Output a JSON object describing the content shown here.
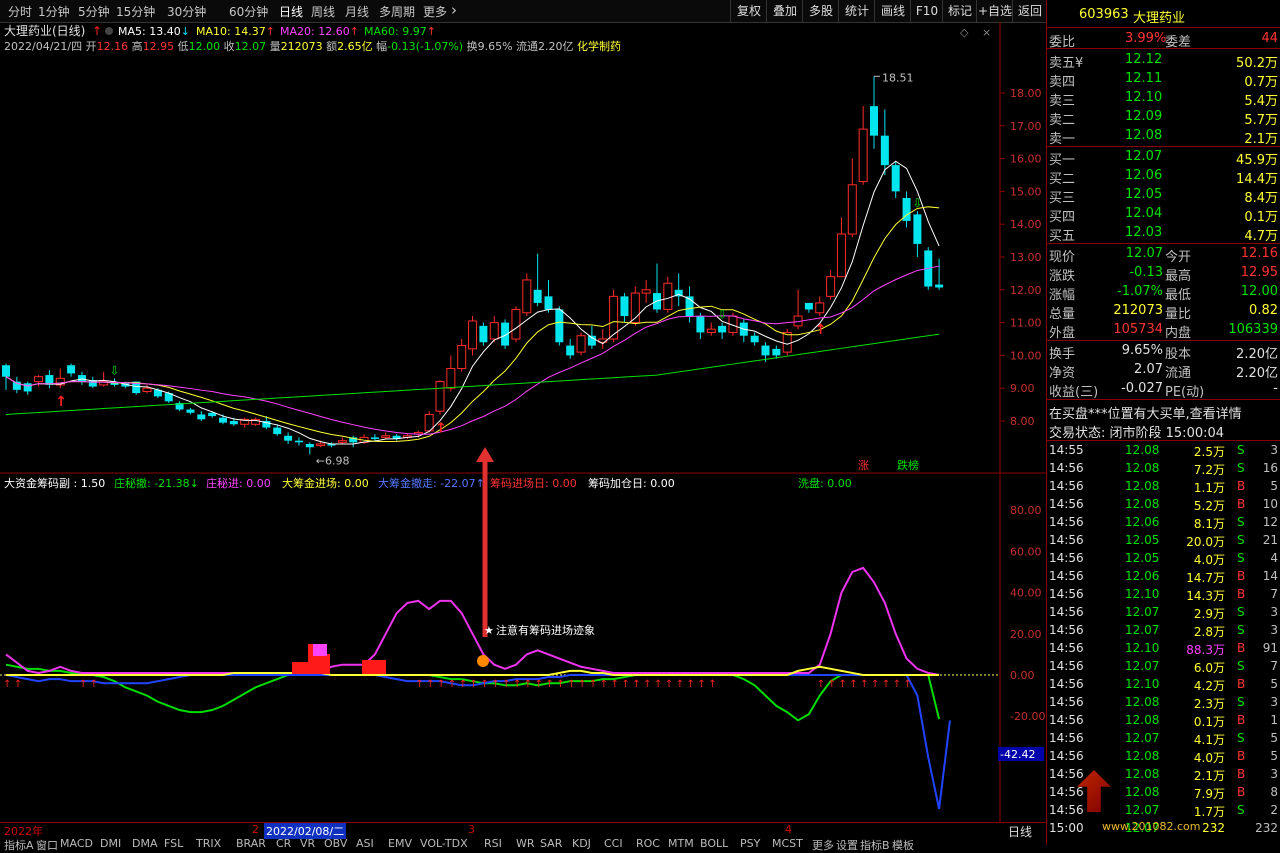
{
  "toolbar": {
    "periods": [
      "分时",
      "1分钟",
      "5分钟",
      "15分钟",
      "30分钟",
      "60分钟",
      "日线",
      "周线",
      "月线",
      "多周期",
      "更多"
    ],
    "active_period": "日线",
    "more_icon": "chevron-right-icon",
    "right_buttons": [
      "复权",
      "叠加",
      "多股",
      "统计",
      "画线",
      "F10",
      "标记",
      "+自选",
      "返回"
    ]
  },
  "main_info": {
    "title": "大理药业(日线)",
    "ma": [
      {
        "label": "MA5: 13.40",
        "arrow": "↓",
        "color": "#ffffff"
      },
      {
        "label": "MA10: 14.37",
        "arrow": "↑",
        "color": "#ffff33"
      },
      {
        "label": "MA20: 12.60",
        "arrow": "↑",
        "color": "#ff44ff"
      },
      {
        "label": "MA60: 9.97",
        "arrow": "↑",
        "color": "#00e000"
      }
    ],
    "quote_date": "2022/04/21/四",
    "quote_items": [
      {
        "label": "开",
        "value": "12.16",
        "color": "#ff3333"
      },
      {
        "label": "高",
        "value": "12.95",
        "color": "#ff3333"
      },
      {
        "label": "低",
        "value": "12.00",
        "color": "#00e000"
      },
      {
        "label": "收",
        "value": "12.07",
        "color": "#00e000"
      },
      {
        "label": "量",
        "value": "212073",
        "color": "#ffff33"
      },
      {
        "label": "额",
        "value": "2.65亿",
        "color": "#ffff33"
      },
      {
        "label": "幅",
        "value": "-0.13(-1.07%)",
        "color": "#00e000"
      },
      {
        "label": "换",
        "value": "9.65%",
        "color": "#c0c0c0"
      },
      {
        "label": "流通",
        "value": "2.20亿",
        "color": "#c0c0c0"
      }
    ],
    "industry": "化学制药",
    "high_label": "18.51",
    "low_label": "6.98",
    "badges": [
      "涨",
      "跌榜"
    ]
  },
  "indicator": {
    "items": [
      {
        "text": "大资金筹码副 : 1.50",
        "color": "#ffffff"
      },
      {
        "text": "庄秘撤: -21.38↓",
        "color": "#00e000"
      },
      {
        "text": "庄秘进: 0.00",
        "color": "#ff44ff"
      },
      {
        "text": "大筹金进场: 0.00",
        "color": "#ffff33"
      },
      {
        "text": "大筹金撤走: -22.07↑",
        "color": "#5577ff"
      },
      {
        "text": "筹码进场日: 0.00",
        "color": "#ff3333"
      },
      {
        "text": "筹码加仓日: 0.00",
        "color": "#ffffff"
      },
      {
        "text": "洗盘: 0.00",
        "color": "#00e000"
      }
    ],
    "annotation": "注意有筹码进场迹象",
    "current_value": "-42.42"
  },
  "axis_main": [
    "18.00",
    "17.00",
    "16.00",
    "15.00",
    "14.00",
    "13.00",
    "12.00",
    "11.00",
    "10.00",
    "9.00",
    "8.00"
  ],
  "axis_ind": [
    "80.00",
    "60.00",
    "40.00",
    "20.00",
    "0.00",
    "-20.00"
  ],
  "timeline": {
    "labels": [
      "2022年",
      "2",
      "2022/02/08/二",
      "3",
      "4"
    ],
    "period": "日线"
  },
  "bottom_tabs": [
    "指标A",
    "窗口",
    "MACD",
    "DMI",
    "DMA",
    "FSL",
    "TRIX",
    "BRAR",
    "CR",
    "VR",
    "OBV",
    "ASI",
    "EMV",
    "VOL-TDX",
    "RSI",
    "WR",
    "SAR",
    "KDJ",
    "CCI",
    "ROC",
    "MTM",
    "BOLL",
    "PSY",
    "MCST",
    "更多",
    "设置",
    "指标B",
    "模板"
  ],
  "quote_panel": {
    "code": "603963",
    "name": "大理药业",
    "webi": {
      "label": "委比",
      "value": "3.99%",
      "label2": "委差",
      "value2": "44"
    },
    "sells": [
      {
        "label": "卖五",
        "price": "12.12",
        "vol": "50.2万"
      },
      {
        "label": "卖四",
        "price": "12.11",
        "vol": "0.7万"
      },
      {
        "label": "卖三",
        "price": "12.10",
        "vol": "5.4万"
      },
      {
        "label": "卖二",
        "price": "12.09",
        "vol": "5.7万"
      },
      {
        "label": "卖一",
        "price": "12.08",
        "vol": "2.1万"
      }
    ],
    "sell5_mark": "¥",
    "buys": [
      {
        "label": "买一",
        "price": "12.07",
        "vol": "45.9万"
      },
      {
        "label": "买二",
        "price": "12.06",
        "vol": "14.4万"
      },
      {
        "label": "买三",
        "price": "12.05",
        "vol": "8.4万"
      },
      {
        "label": "买四",
        "price": "12.04",
        "vol": "0.1万"
      },
      {
        "label": "买五",
        "price": "12.03",
        "vol": "4.7万"
      }
    ],
    "stats": [
      {
        "l1": "现价",
        "v1": "12.07",
        "c1": "#00e000",
        "l2": "今开",
        "v2": "12.16",
        "c2": "#ff3333"
      },
      {
        "l1": "涨跌",
        "v1": "-0.13",
        "c1": "#00e000",
        "l2": "最高",
        "v2": "12.95",
        "c2": "#ff3333"
      },
      {
        "l1": "涨幅",
        "v1": "-1.07%",
        "c1": "#00e000",
        "l2": "最低",
        "v2": "12.00",
        "c2": "#00e000"
      },
      {
        "l1": "总量",
        "v1": "212073",
        "c1": "#ffff33",
        "l2": "量比",
        "v2": "0.82",
        "c2": "#ffff33"
      },
      {
        "l1": "外盘",
        "v1": "105734",
        "c1": "#ff3333",
        "l2": "内盘",
        "v2": "106339",
        "c2": "#00e000"
      }
    ],
    "stats2": [
      {
        "l1": "换手",
        "v1": "9.65%",
        "l2": "股本",
        "v2": "2.20亿"
      },
      {
        "l1": "净资",
        "v1": "2.07",
        "l2": "流通",
        "v2": "2.20亿"
      },
      {
        "l1": "收益(三)",
        "v1": "-0.027",
        "l2": "PE(动)",
        "v2": "-"
      }
    ],
    "notice": "在买盘***位置有大买单,查看详情",
    "status": "交易状态: 闭市阶段 15:00:04",
    "ticks": [
      {
        "t": "14:55",
        "p": "12.08",
        "v": "2.5万",
        "s": "S",
        "n": "3",
        "pc": "#00e000",
        "vc": "#ffff33"
      },
      {
        "t": "14:56",
        "p": "12.08",
        "v": "7.2万",
        "s": "S",
        "n": "16",
        "pc": "#00e000",
        "vc": "#ffff33"
      },
      {
        "t": "14:56",
        "p": "12.08",
        "v": "1.1万",
        "s": "B",
        "n": "5",
        "pc": "#00e000",
        "vc": "#ffff33"
      },
      {
        "t": "14:56",
        "p": "12.08",
        "v": "5.2万",
        "s": "B",
        "n": "10",
        "pc": "#00e000",
        "vc": "#ffff33"
      },
      {
        "t": "14:56",
        "p": "12.06",
        "v": "8.1万",
        "s": "S",
        "n": "12",
        "pc": "#00e000",
        "vc": "#ffff33"
      },
      {
        "t": "14:56",
        "p": "12.05",
        "v": "20.0万",
        "s": "S",
        "n": "21",
        "pc": "#00e000",
        "vc": "#ffff33"
      },
      {
        "t": "14:56",
        "p": "12.05",
        "v": "4.0万",
        "s": "S",
        "n": "4",
        "pc": "#00e000",
        "vc": "#ffff33"
      },
      {
        "t": "14:56",
        "p": "12.06",
        "v": "14.7万",
        "s": "B",
        "n": "14",
        "pc": "#00e000",
        "vc": "#ffff33"
      },
      {
        "t": "14:56",
        "p": "12.10",
        "v": "14.3万",
        "s": "B",
        "n": "7",
        "pc": "#00e000",
        "vc": "#ffff33"
      },
      {
        "t": "14:56",
        "p": "12.07",
        "v": "2.9万",
        "s": "S",
        "n": "3",
        "pc": "#00e000",
        "vc": "#ffff33"
      },
      {
        "t": "14:56",
        "p": "12.07",
        "v": "2.8万",
        "s": "S",
        "n": "3",
        "pc": "#00e000",
        "vc": "#ffff33"
      },
      {
        "t": "14:56",
        "p": "12.10",
        "v": "88.3万",
        "s": "B",
        "n": "91",
        "pc": "#00e000",
        "vc": "#ff44ff"
      },
      {
        "t": "14:56",
        "p": "12.07",
        "v": "6.0万",
        "s": "S",
        "n": "7",
        "pc": "#00e000",
        "vc": "#ffff33"
      },
      {
        "t": "14:56",
        "p": "12.10",
        "v": "4.2万",
        "s": "B",
        "n": "5",
        "pc": "#00e000",
        "vc": "#ffff33"
      },
      {
        "t": "14:56",
        "p": "12.08",
        "v": "2.3万",
        "s": "S",
        "n": "3",
        "pc": "#00e000",
        "vc": "#ffff33"
      },
      {
        "t": "14:56",
        "p": "12.08",
        "v": "0.1万",
        "s": "B",
        "n": "1",
        "pc": "#00e000",
        "vc": "#ffff33"
      },
      {
        "t": "14:56",
        "p": "12.07",
        "v": "4.1万",
        "s": "S",
        "n": "5",
        "pc": "#00e000",
        "vc": "#ffff33"
      },
      {
        "t": "14:56",
        "p": "12.08",
        "v": "4.0万",
        "s": "B",
        "n": "5",
        "pc": "#00e000",
        "vc": "#ffff33"
      },
      {
        "t": "14:56",
        "p": "12.08",
        "v": "2.1万",
        "s": "B",
        "n": "3",
        "pc": "#00e000",
        "vc": "#ffff33"
      },
      {
        "t": "14:56",
        "p": "12.08",
        "v": "7.9万",
        "s": "B",
        "n": "8",
        "pc": "#00e000",
        "vc": "#ffff33"
      },
      {
        "t": "14:56",
        "p": "12.07",
        "v": "1.7万",
        "s": "S",
        "n": "2",
        "pc": "#00e000",
        "vc": "#ffff33"
      },
      {
        "t": "15:00",
        "p": "12.07",
        "v": "232",
        "s": "",
        "n": "232",
        "pc": "#00e000",
        "vc": "#ffff33"
      }
    ]
  },
  "watermark": "www.201082.com",
  "candles": [
    [
      9.7,
      9.35,
      9.75,
      8.95
    ],
    [
      9.2,
      8.95,
      9.35,
      8.85
    ],
    [
      9.15,
      8.9,
      9.2,
      8.8
    ],
    [
      9.2,
      9.35,
      9.4,
      9.05
    ],
    [
      9.4,
      9.1,
      9.55,
      9.0
    ],
    [
      9.1,
      9.3,
      9.6,
      9.0
    ],
    [
      9.7,
      9.45,
      9.75,
      9.35
    ],
    [
      9.4,
      9.2,
      9.5,
      9.1
    ],
    [
      9.25,
      9.05,
      9.35,
      9.0
    ],
    [
      9.1,
      9.2,
      9.5,
      9.05
    ],
    [
      9.2,
      9.1,
      9.3,
      9.05
    ],
    [
      9.15,
      9.05,
      9.2,
      9.0
    ],
    [
      9.2,
      8.85,
      9.2,
      8.8
    ],
    [
      8.9,
      9.0,
      9.1,
      8.85
    ],
    [
      8.95,
      8.75,
      9.0,
      8.7
    ],
    [
      8.85,
      8.6,
      8.9,
      8.55
    ],
    [
      8.55,
      8.35,
      8.6,
      8.3
    ],
    [
      8.35,
      8.25,
      8.4,
      8.2
    ],
    [
      8.2,
      8.05,
      8.3,
      8.0
    ],
    [
      8.25,
      8.15,
      8.3,
      8.1
    ],
    [
      8.1,
      7.95,
      8.2,
      7.9
    ],
    [
      8.0,
      7.9,
      8.1,
      7.85
    ],
    [
      7.9,
      8.05,
      8.1,
      7.8
    ],
    [
      7.9,
      8.05,
      8.1,
      7.85
    ],
    [
      8.0,
      7.8,
      8.15,
      7.75
    ],
    [
      7.8,
      7.6,
      7.9,
      7.55
    ],
    [
      7.55,
      7.4,
      7.65,
      7.3
    ],
    [
      7.4,
      7.35,
      7.5,
      7.25
    ],
    [
      7.3,
      7.2,
      7.35,
      6.98
    ],
    [
      7.25,
      7.3,
      7.4,
      7.2
    ],
    [
      7.3,
      7.25,
      7.35,
      7.2
    ],
    [
      7.35,
      7.4,
      7.5,
      7.3
    ],
    [
      7.5,
      7.35,
      7.55,
      7.2
    ],
    [
      7.35,
      7.5,
      7.6,
      7.3
    ],
    [
      7.5,
      7.45,
      7.6,
      7.4
    ],
    [
      7.5,
      7.55,
      7.65,
      7.45
    ],
    [
      7.55,
      7.45,
      7.6,
      7.4
    ],
    [
      7.5,
      7.55,
      7.6,
      7.45
    ],
    [
      7.6,
      7.65,
      7.7,
      7.5
    ],
    [
      7.7,
      8.2,
      8.3,
      7.65
    ],
    [
      8.3,
      9.2,
      9.25,
      8.2
    ],
    [
      9.0,
      9.6,
      10.0,
      8.9
    ],
    [
      9.6,
      10.3,
      10.5,
      9.5
    ],
    [
      10.2,
      11.05,
      11.2,
      10.0
    ],
    [
      10.9,
      10.4,
      11.0,
      10.3
    ],
    [
      10.5,
      11.0,
      11.2,
      10.4
    ],
    [
      11.0,
      10.3,
      11.1,
      10.2
    ],
    [
      10.5,
      11.4,
      11.5,
      10.4
    ],
    [
      11.3,
      12.3,
      12.5,
      11.2
    ],
    [
      12.0,
      11.6,
      13.1,
      11.5
    ],
    [
      11.8,
      11.4,
      12.3,
      11.3
    ],
    [
      11.4,
      10.4,
      11.5,
      10.3
    ],
    [
      10.3,
      10.0,
      10.5,
      9.9
    ],
    [
      10.1,
      10.6,
      10.7,
      10.0
    ],
    [
      10.6,
      10.3,
      10.9,
      10.2
    ],
    [
      10.4,
      10.5,
      10.8,
      10.2
    ],
    [
      10.5,
      11.8,
      12.0,
      10.4
    ],
    [
      11.8,
      11.2,
      11.9,
      11.0
    ],
    [
      11.0,
      11.9,
      12.1,
      10.9
    ],
    [
      11.9,
      12.0,
      12.3,
      11.6
    ],
    [
      11.9,
      11.4,
      12.8,
      11.3
    ],
    [
      11.4,
      12.2,
      12.4,
      11.3
    ],
    [
      12.0,
      11.8,
      12.5,
      11.5
    ],
    [
      11.8,
      11.2,
      12.1,
      11.0
    ],
    [
      11.2,
      10.7,
      11.3,
      10.5
    ],
    [
      10.7,
      10.8,
      11.0,
      10.6
    ],
    [
      10.9,
      10.7,
      11.0,
      10.5
    ],
    [
      10.7,
      11.2,
      11.3,
      10.6
    ],
    [
      11.0,
      10.6,
      11.1,
      10.4
    ],
    [
      10.6,
      10.4,
      10.7,
      10.3
    ],
    [
      10.3,
      10.0,
      10.4,
      9.8
    ],
    [
      10.2,
      10.0,
      10.3,
      9.9
    ],
    [
      10.1,
      10.7,
      10.8,
      10.0
    ],
    [
      10.9,
      11.2,
      12.0,
      10.8
    ],
    [
      11.6,
      11.4,
      11.6,
      11.3
    ],
    [
      11.3,
      11.6,
      11.8,
      11.2
    ],
    [
      11.8,
      12.4,
      12.6,
      11.7
    ],
    [
      12.4,
      13.7,
      14.2,
      12.4
    ],
    [
      13.7,
      15.2,
      16.0,
      13.6
    ],
    [
      15.3,
      16.9,
      17.6,
      15.2
    ],
    [
      17.6,
      16.7,
      18.51,
      16.3
    ],
    [
      16.7,
      15.8,
      17.5,
      15.5
    ],
    [
      15.8,
      15.0,
      15.9,
      14.8
    ],
    [
      14.8,
      14.1,
      15.0,
      13.9
    ],
    [
      14.3,
      13.4,
      14.4,
      13.0
    ],
    [
      13.2,
      12.1,
      13.3,
      12.0
    ],
    [
      12.16,
      12.07,
      12.95,
      12.0
    ]
  ],
  "ind_series": {
    "green": [
      5,
      4,
      3,
      3,
      2,
      2,
      1,
      1,
      0,
      -1,
      -3,
      -6,
      -8,
      -10,
      -13,
      -15,
      -17,
      -18,
      -18,
      -17,
      -15,
      -12,
      -9,
      -6,
      -4,
      -2,
      0,
      0,
      0,
      0,
      0,
      0,
      0,
      0,
      0,
      0,
      0,
      0,
      0,
      0,
      -1,
      -2,
      -2,
      -3,
      -4,
      -4,
      -5,
      -5,
      -4,
      -5,
      -4,
      -4,
      -3,
      -3,
      -3,
      -2,
      -2,
      -1,
      0,
      0,
      0,
      0,
      0,
      0,
      0,
      0,
      0,
      0,
      -2,
      -5,
      -10,
      -15,
      -18,
      -22,
      -19,
      -10,
      -3,
      0,
      0,
      0,
      0,
      0,
      0,
      0,
      0,
      0,
      -21.38
    ],
    "mag": [
      10,
      6,
      2,
      1,
      2,
      4,
      2,
      1,
      1,
      1,
      1,
      1,
      1,
      1,
      1,
      1,
      1,
      1,
      1,
      1,
      1,
      1,
      1,
      1,
      1,
      1,
      1,
      1,
      1,
      2,
      4,
      5,
      5,
      5,
      10,
      20,
      30,
      35,
      36,
      32,
      36,
      36,
      30,
      20,
      10,
      5,
      3,
      5,
      10,
      12,
      10,
      8,
      6,
      4,
      3,
      2,
      1,
      1,
      1,
      1,
      1,
      1,
      1,
      1,
      1,
      1,
      1,
      1,
      1,
      1,
      1,
      1,
      1,
      1,
      1,
      5,
      20,
      40,
      50,
      52,
      45,
      35,
      20,
      8,
      3,
      1,
      0
    ],
    "blue": [
      0,
      -1,
      -2,
      -3,
      -2,
      -2,
      -3,
      -3,
      -3,
      -4,
      -4,
      -4,
      -4,
      -4,
      -3,
      -2,
      -1,
      0,
      0,
      0,
      0,
      0,
      0,
      0,
      0,
      0,
      0,
      0,
      0,
      0,
      0,
      0,
      0,
      0,
      0,
      -1,
      -2,
      -3,
      -3,
      -3,
      -3,
      -4,
      -5,
      -5,
      -4,
      -3,
      -3,
      -2,
      -2,
      -2,
      -1,
      -1,
      0,
      0,
      0,
      0,
      0,
      0,
      0,
      0,
      0,
      0,
      0,
      0,
      0,
      0,
      0,
      0,
      0,
      0,
      0,
      0,
      0,
      0,
      0,
      0,
      0,
      0,
      0,
      0,
      0,
      0,
      0,
      0,
      -10,
      -40,
      -65,
      -22.07
    ],
    "yellow": [
      0,
      0,
      0,
      0,
      0,
      0,
      0,
      0,
      0,
      0,
      0,
      0,
      0,
      0,
      0,
      0,
      0,
      0,
      0,
      0,
      0,
      1,
      1,
      1,
      1,
      1,
      1,
      1,
      1,
      1,
      0,
      0,
      0,
      0,
      0,
      0,
      0,
      0,
      0,
      0,
      0,
      0,
      0,
      0,
      0,
      0,
      0,
      0,
      0,
      0,
      0,
      1,
      2,
      2,
      1,
      1,
      0,
      0,
      0,
      0,
      0,
      0,
      0,
      0,
      0,
      0,
      0,
      0,
      0,
      0,
      0,
      0,
      0,
      2,
      3,
      4,
      3,
      2,
      1,
      0,
      0,
      0,
      0,
      0,
      0,
      0,
      0
    ]
  }
}
